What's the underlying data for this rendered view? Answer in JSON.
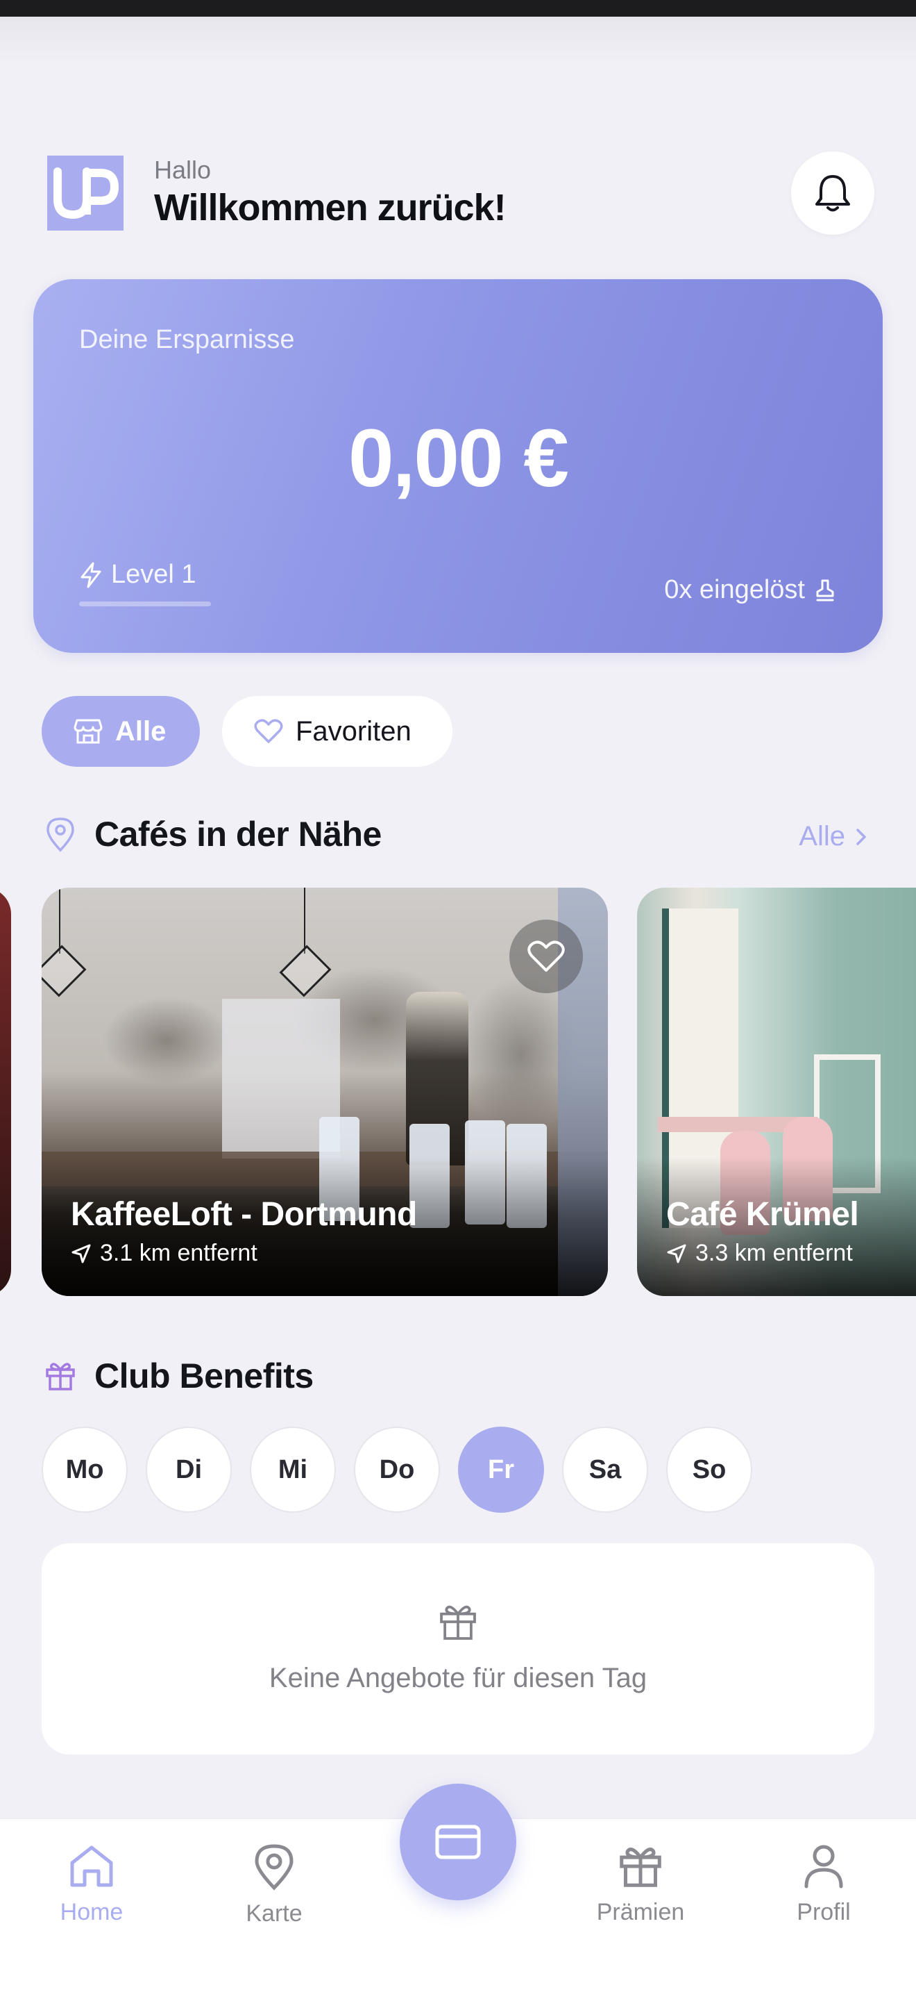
{
  "header": {
    "logo_text": "UP",
    "greeting_small": "Hallo",
    "greeting_title": "Willkommen zurück!"
  },
  "savings": {
    "label": "Deine Ersparnisse",
    "amount": "0,00 €",
    "level": "Level 1",
    "level_progress": 0,
    "redeemed": "0x eingelöst"
  },
  "filters": [
    {
      "label": "Alle",
      "icon": "store-icon",
      "active": true
    },
    {
      "label": "Favoriten",
      "icon": "heart-icon",
      "active": false
    }
  ],
  "cafes_section": {
    "title": "Cafés in der Nähe",
    "see_all": "Alle",
    "cafes": [
      {
        "name": "KaffeeLoft - Dortmund",
        "distance": "3.1 km entfernt"
      },
      {
        "name": "Café Krümel",
        "distance": "3.3 km entfernt"
      }
    ]
  },
  "benefits": {
    "title": "Club Benefits",
    "days": [
      "Mo",
      "Di",
      "Mi",
      "Do",
      "Fr",
      "Sa",
      "So"
    ],
    "active_day": "Fr",
    "empty_message": "Keine Angebote für diesen Tag"
  },
  "nav": {
    "items": [
      {
        "label": "Home",
        "icon": "home-icon",
        "active": true
      },
      {
        "label": "Karte",
        "icon": "map-pin-icon",
        "active": false
      },
      {
        "label": "Prämien",
        "icon": "gift-icon",
        "active": false
      },
      {
        "label": "Profil",
        "icon": "user-icon",
        "active": false
      }
    ],
    "center_icon": "card-icon"
  },
  "colors": {
    "accent": "#a9adef",
    "background": "#f1f0f6",
    "card_gradient_start": "#a9b0f1",
    "card_gradient_end": "#7d83da"
  }
}
